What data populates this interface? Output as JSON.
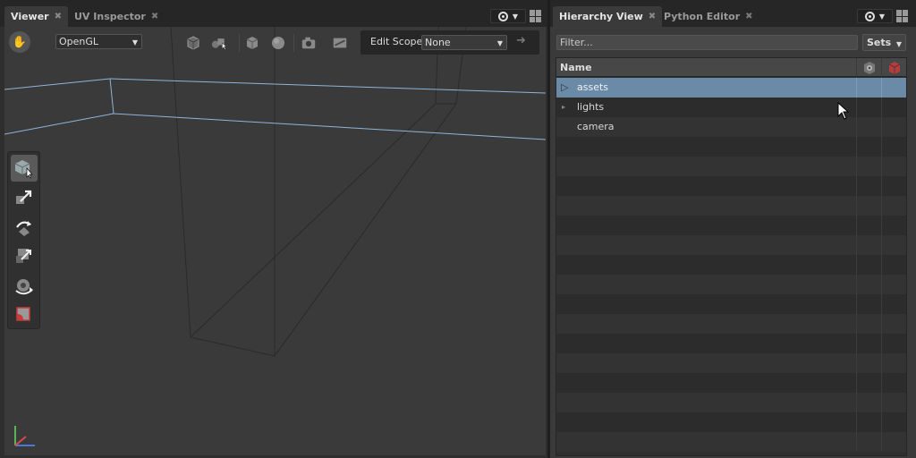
{
  "left_panel": {
    "tabs": [
      {
        "label": "Viewer",
        "active": true
      },
      {
        "label": "UV Inspector",
        "active": false
      }
    ],
    "pin_arrow": "▼"
  },
  "viewer": {
    "toolbar": {
      "renderer": "OpenGL",
      "icons": [
        "hand-icon",
        "box-view-icon",
        "shapes-icon",
        "cube-icon",
        "sphere-icon",
        "camera-icon",
        "display-options-icon"
      ],
      "edit_scope_label": "Edit Scope",
      "edit_scope_value": "None"
    },
    "tools": [
      "select-tool",
      "translate-tool",
      "rotate-tool",
      "scale-tool",
      "camera-tool",
      "crop-tool"
    ]
  },
  "right_panel": {
    "tabs": [
      {
        "label": "Hierarchy View",
        "active": true
      },
      {
        "label": "Python Editor",
        "active": false
      }
    ],
    "pin_arrow": "▼"
  },
  "hierarchy": {
    "filter_placeholder": "Filter...",
    "sets_label": "Sets",
    "columns": {
      "name": "Name",
      "visibility_icon": "visibility-cube-icon",
      "inclusion_icon": "red-cube-icon"
    },
    "rows": [
      {
        "label": "assets",
        "expandable": true,
        "selected": true
      },
      {
        "label": "lights",
        "expandable": true,
        "selected": false
      },
      {
        "label": "camera",
        "expandable": false,
        "selected": false
      }
    ]
  },
  "colors": {
    "selection": "#6a8aa8",
    "viewport_bg": "#3a3a3a",
    "wire_highlight": "#8fb4d8",
    "accent_red": "#c83a3a"
  }
}
